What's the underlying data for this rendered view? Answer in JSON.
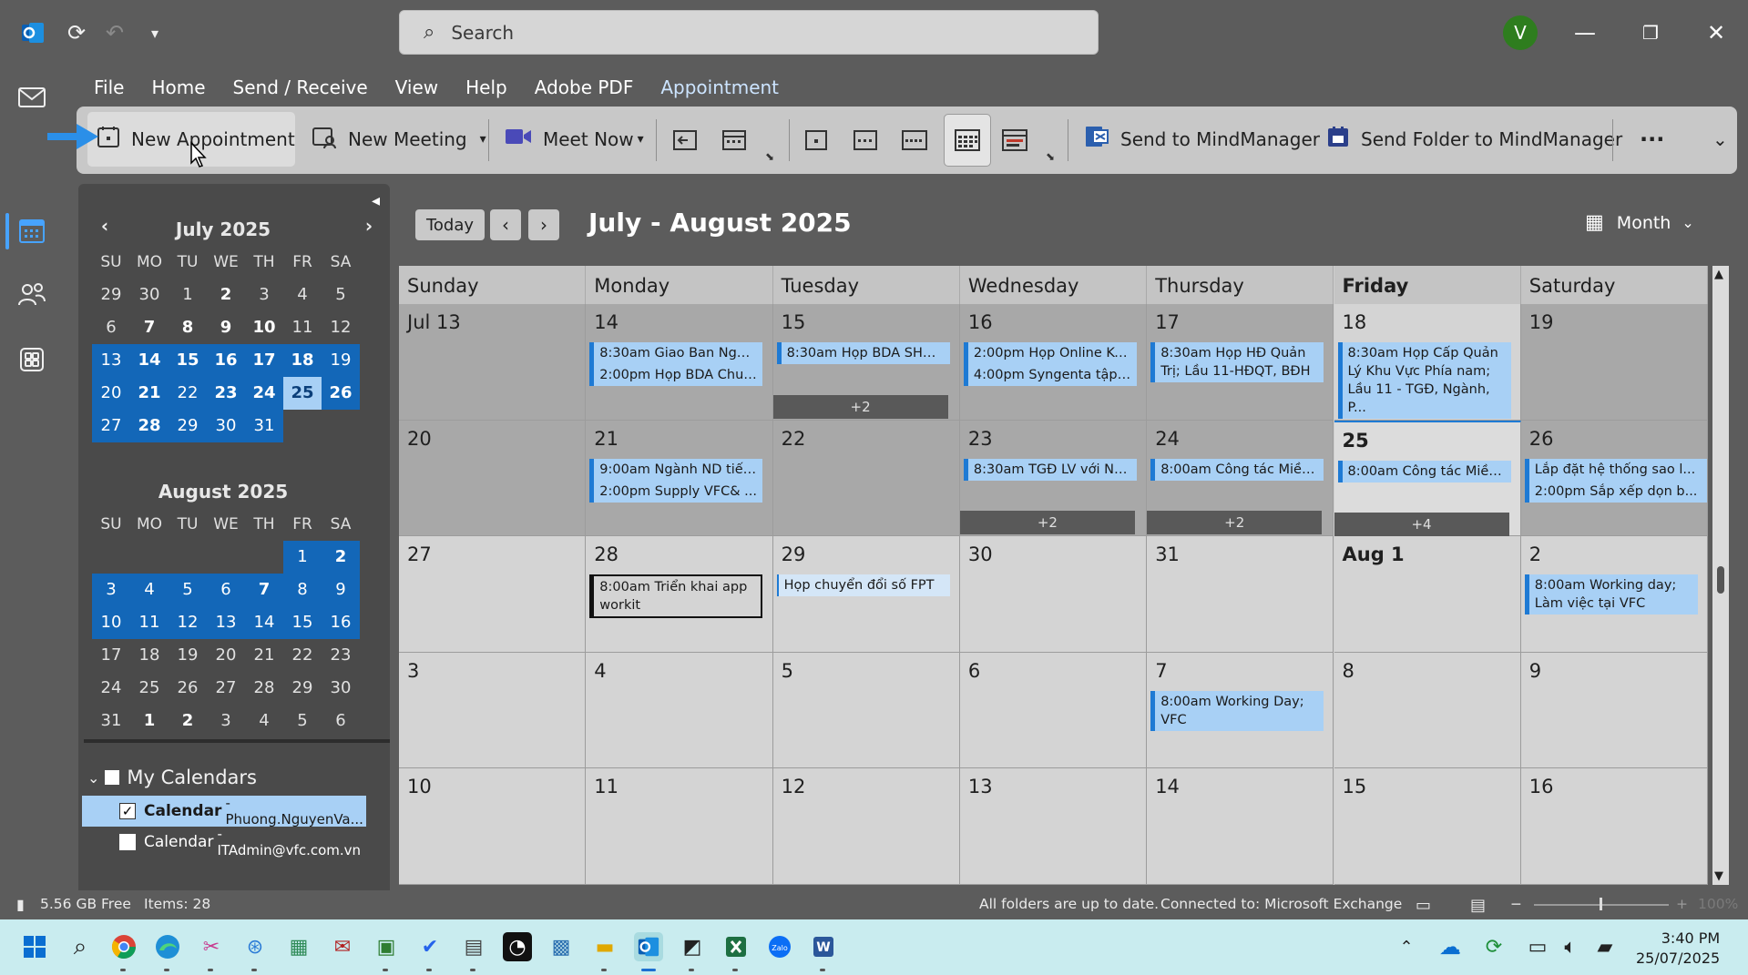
{
  "titlebar": {
    "search_placeholder": "Search",
    "avatar_initial": "V"
  },
  "menu": [
    "File",
    "Home",
    "Send / Receive",
    "View",
    "Help",
    "Adobe PDF",
    "Appointment"
  ],
  "ribbon": {
    "new_appointment": "New Appointment",
    "new_meeting": "New Meeting",
    "meet_now": "Meet Now",
    "send_to_mindmanager": "Send to MindManager",
    "send_folder_to_mindmanager": "Send Folder to MindManager",
    "more": "···"
  },
  "mini_calendars": [
    {
      "title": "July 2025",
      "day_headers": [
        "SU",
        "MO",
        "TU",
        "WE",
        "TH",
        "FR",
        "SA"
      ],
      "weeks": [
        [
          "29",
          "30",
          "1",
          "2",
          "3",
          "4",
          "5"
        ],
        [
          "6",
          "7",
          "8",
          "9",
          "10",
          "11",
          "12"
        ],
        [
          "13",
          "14",
          "15",
          "16",
          "17",
          "18",
          "19"
        ],
        [
          "20",
          "21",
          "22",
          "23",
          "24",
          "25",
          "26"
        ],
        [
          "27",
          "28",
          "29",
          "30",
          "31",
          "",
          ""
        ]
      ]
    },
    {
      "title": "August 2025",
      "day_headers": [
        "SU",
        "MO",
        "TU",
        "WE",
        "TH",
        "FR",
        "SA"
      ],
      "weeks": [
        [
          "",
          "",
          "",
          "",
          "",
          "1",
          "2"
        ],
        [
          "3",
          "4",
          "5",
          "6",
          "7",
          "8",
          "9"
        ],
        [
          "10",
          "11",
          "12",
          "13",
          "14",
          "15",
          "16"
        ],
        [
          "17",
          "18",
          "19",
          "20",
          "21",
          "22",
          "23"
        ],
        [
          "24",
          "25",
          "26",
          "27",
          "28",
          "29",
          "30"
        ],
        [
          "31",
          "1",
          "2",
          "3",
          "4",
          "5",
          "6"
        ]
      ]
    }
  ],
  "my_calendars": {
    "header": "My Calendars",
    "items": [
      {
        "name": "Calendar",
        "account": " - Phuong.NguyenVa...",
        "checked": true
      },
      {
        "name": "Calendar",
        "account": " - ITAdmin@vfc.com.vn",
        "checked": false
      }
    ]
  },
  "calendar": {
    "today_label": "Today",
    "range_title": "July - August 2025",
    "view_label": "Month",
    "day_headers": [
      "Sunday",
      "Monday",
      "Tuesday",
      "Wednesday",
      "Thursday",
      "Friday",
      "Saturday"
    ],
    "weeks": [
      {
        "days": [
          "Jul 13",
          "14",
          "15",
          "16",
          "17",
          "18",
          "19"
        ],
        "events": [
          [],
          [
            "8:30am Giao Ban Ngàn...",
            "2:00pm Họp BDA Chuy..."
          ],
          [
            "8:30am Họp BDA SH&..."
          ],
          [
            "2:00pm Họp Online Ku...",
            "4:00pm Syngenta tập h..."
          ],
          [
            "8:30am Họp HĐ Quản Trị; Lầu 11-HĐQT, BĐH"
          ],
          [
            "8:30am Họp Cấp Quản Lý Khu Vực Phía nam; Lầu 11 - TGĐ, Ngành, P..."
          ],
          []
        ],
        "more": [
          "",
          "",
          "+2",
          "",
          "",
          "",
          ""
        ]
      },
      {
        "days": [
          "20",
          "21",
          "22",
          "23",
          "24",
          "25",
          "26"
        ],
        "events": [
          [],
          [
            "9:00am Ngành ND tiếp...",
            "2:00pm Supply VFC& ..."
          ],
          [],
          [
            "8:30am TGĐ LV với Ng..."
          ],
          [
            "8:00am Công tác Miền ..."
          ],
          [
            "8:00am Công tác Miền ..."
          ],
          [
            "Lắp đặt hệ thống sao l...",
            "2:00pm Sắp xếp dọn b..."
          ]
        ],
        "more": [
          "",
          "",
          "",
          "+2",
          "+2",
          "+4",
          ""
        ]
      },
      {
        "days": [
          "27",
          "28",
          "29",
          "30",
          "31",
          "Aug 1",
          "2"
        ],
        "events": [
          [],
          [
            "8:00am Triển  khai  app workit"
          ],
          [
            "Họp chuyển đổi số FPT"
          ],
          [],
          [],
          [],
          [
            "8:00am Working day; Làm việc tại VFC"
          ]
        ],
        "more": [
          "",
          "",
          "",
          "",
          "",
          "",
          ""
        ]
      },
      {
        "days": [
          "3",
          "4",
          "5",
          "6",
          "7",
          "8",
          "9"
        ],
        "events": [
          [],
          [],
          [],
          [],
          [
            "8:00am Working Day; VFC"
          ],
          [],
          []
        ],
        "more": [
          "",
          "",
          "",
          "",
          "",
          "",
          ""
        ]
      },
      {
        "days": [
          "10",
          "11",
          "12",
          "13",
          "14",
          "15",
          "16"
        ],
        "events": [
          [],
          [],
          [],
          [],
          [],
          [],
          []
        ],
        "more": [
          "",
          "",
          "",
          "",
          "",
          "",
          ""
        ]
      }
    ]
  },
  "status": {
    "disk_free": "5.56 GB Free",
    "items": "Items: 28",
    "sync": "All folders are up to date.",
    "connection": "Connected to: Microsoft Exchange",
    "zoom": "100%"
  },
  "taskbar": {
    "time": "3:40 PM",
    "date": "25/07/2025"
  },
  "colors": {
    "accent": "#1367b8",
    "event_bg": "#a8d0f5",
    "event_border": "#1e7ad4",
    "avatar": "#2e7d1e"
  }
}
